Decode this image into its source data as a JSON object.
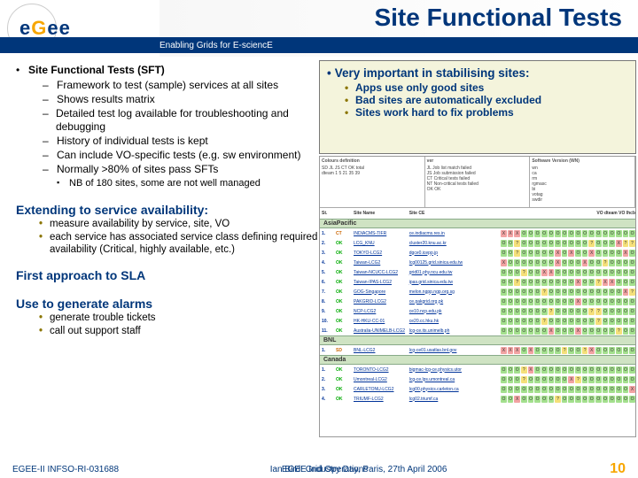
{
  "logo_letters": {
    "e1": "e",
    "g": "G",
    "e2": "e",
    "e3": "e"
  },
  "tagline": "Enabling Grids for E-sciencE",
  "page_title": "Site Functional Tests",
  "left": {
    "heading": "Site Functional Tests (SFT)",
    "items": [
      "Framework to test (sample) services at all sites",
      "Shows results matrix",
      "Detailed test log available for troubleshooting and debugging",
      "History of individual tests is kept",
      "Can include VO-specific tests (e.g. sw environment)",
      "Normally >80% of sites pass SFTs"
    ],
    "subnote": "NB of 180 sites, some are not well managed",
    "h2a": "Extending to service availability:",
    "h2a_bullets": [
      "measure availability by service, site, VO",
      "each service has associated service class defining required availability (Critical, highly available, etc.)"
    ],
    "h2b": "First approach to SLA",
    "h2c": "Use to generate alarms",
    "h2c_bullets": [
      "generate trouble tickets",
      "call out support staff"
    ]
  },
  "callout": {
    "lead": "Very important in stabilising sites:",
    "bullets": [
      "Apps use only good sites",
      "Bad sites are automatically excluded",
      "Sites work hard to fix problems"
    ]
  },
  "matrix": {
    "legend": {
      "col1_h": "Colours definition",
      "col1_rows": [
        "SD  JL  JS  CT  OK  total",
        "dteam   1   5  21  35  39"
      ],
      "col2_h": "ver",
      "col2_rows": [
        "JL  Job list match failed",
        "JS  Job submission failed",
        "CT  Critical tests failed",
        "NT  Non-critical tests failed",
        "OK  OK"
      ],
      "col3_h": "Software Version (WN)",
      "col3_rows": [
        "wn",
        "ca",
        "rm",
        "rgmasc",
        "bi",
        "votag",
        "swdir"
      ]
    },
    "thead": {
      "idx": "St.",
      "site": "Site Name",
      "ce": "Site CE",
      "right": "VO dteam                                       VO lhcb"
    },
    "regions": [
      "AsiaPacific",
      "BNL",
      "Canada"
    ],
    "rows_ap": [
      {
        "idx": "1.",
        "stat": "CT",
        "site": "INDIACMS-TIFR",
        "ce": "ce.indiacms.res.in"
      },
      {
        "idx": "2.",
        "stat": "OK",
        "site": "LCG_KNU",
        "ce": "cluster20.knu.ac.kr"
      },
      {
        "idx": "3.",
        "stat": "OK",
        "site": "TOKYO-LCG2",
        "ce": "dgce0.icepp.jp"
      },
      {
        "idx": "4.",
        "stat": "OK",
        "site": "Taiwan-LCG2",
        "ce": "lcg00125.grid.sinica.edu.tw"
      },
      {
        "idx": "5.",
        "stat": "OK",
        "site": "Taiwan-NCUCC-LCG2",
        "ce": "grid01.phy.ncu.edu.tw"
      },
      {
        "idx": "6.",
        "stat": "OK",
        "site": "Taiwan-IPAS-LCG2",
        "ce": "ipas.grid.sinica.edu.tw"
      },
      {
        "idx": "7.",
        "stat": "OK",
        "site": "GOG-Singapore",
        "ce": "melon.ngpp.ngp.org.sg"
      },
      {
        "idx": "8.",
        "stat": "OK",
        "site": "PAKGRID-LCG2",
        "ce": "ce.pakgrid.org.pk"
      },
      {
        "idx": "9.",
        "stat": "OK",
        "site": "NCP-LCG2",
        "ce": "ce10.ncp.edu.pk"
      },
      {
        "idx": "10.",
        "stat": "OK",
        "site": "HK-HKU-CC-01",
        "ce": "ce20.cc.hku.hk"
      },
      {
        "idx": "11.",
        "stat": "OK",
        "site": "Australia-UNIMELB-LCG2",
        "ce": "lcg-ce.its.unimelb.ph"
      }
    ],
    "rows_bnl": [
      {
        "idx": "1.",
        "stat": "SD",
        "site": "BNL-LCG2",
        "ce": "lcg-ce01.usatlas.bnl.gov"
      }
    ],
    "rows_ca": [
      {
        "idx": "1.",
        "stat": "OK",
        "site": "TORONTO-LCG2",
        "ce": "bigmac-lcg-ce.physics.utor"
      },
      {
        "idx": "2.",
        "stat": "OK",
        "site": "Umontreal-LCG2",
        "ce": "lcg-ce.lps.umontreal.ca"
      },
      {
        "idx": "3.",
        "stat": "OK",
        "site": "CARLETONU-LCG2",
        "ce": "lcg00.physics.carleton.ca"
      },
      {
        "idx": "4.",
        "stat": "OK",
        "site": "TRIUMF-LCG2",
        "ce": "lcg02.triumf.ca"
      }
    ]
  },
  "footer": {
    "left": "EGEE-II INFSO-RI-031688",
    "center": "Ian Bird: Grid Operations",
    "right": "EGEE Industry Day, Paris, 27th April 2006",
    "page": "10"
  }
}
